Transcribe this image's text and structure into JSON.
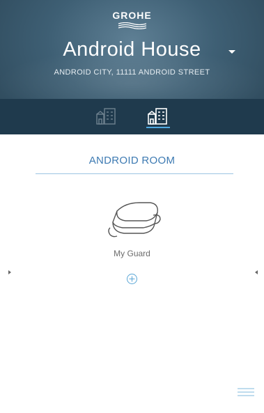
{
  "header": {
    "brand": "GROHE",
    "house_name": "Android House",
    "address": "ANDROID CITY, 11111 ANDROID STREET"
  },
  "tabs": [
    {
      "icon": "buildings-outline-icon",
      "state": "inactive"
    },
    {
      "icon": "buildings-outline-icon",
      "state": "active"
    }
  ],
  "room": {
    "title": "ANDROID ROOM"
  },
  "device": {
    "label": "My Guard",
    "icon": "guard-sensor-icon"
  },
  "actions": {
    "add_icon": "plus-circle-icon",
    "menu_icon": "hamburger-menu-icon"
  },
  "colors": {
    "header_bg": "#3e5f74",
    "tabbar_bg": "#1f3a4d",
    "accent": "#4fa8e0",
    "room_title": "#3d7ab2"
  }
}
